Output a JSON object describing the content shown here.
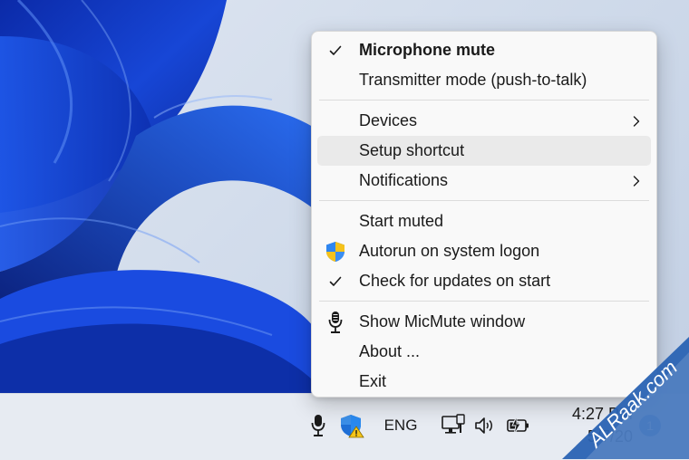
{
  "menu": {
    "items": [
      {
        "label": "Microphone mute",
        "checked": true,
        "bold": true,
        "icon": "",
        "submenu": false,
        "highlighted": false,
        "separator_after": false
      },
      {
        "label": "Transmitter mode (push-to-talk)",
        "checked": false,
        "bold": false,
        "icon": "",
        "submenu": false,
        "highlighted": false,
        "separator_after": true
      },
      {
        "label": "Devices",
        "checked": false,
        "bold": false,
        "icon": "",
        "submenu": true,
        "highlighted": false,
        "separator_after": false
      },
      {
        "label": "Setup shortcut",
        "checked": false,
        "bold": false,
        "icon": "",
        "submenu": false,
        "highlighted": true,
        "separator_after": false
      },
      {
        "label": "Notifications",
        "checked": false,
        "bold": false,
        "icon": "",
        "submenu": true,
        "highlighted": false,
        "separator_after": true
      },
      {
        "label": "Start muted",
        "checked": false,
        "bold": false,
        "icon": "",
        "submenu": false,
        "highlighted": false,
        "separator_after": false
      },
      {
        "label": "Autorun on system logon",
        "checked": false,
        "bold": false,
        "icon": "uac-shield-icon",
        "submenu": false,
        "highlighted": false,
        "separator_after": false
      },
      {
        "label": "Check for updates on start",
        "checked": true,
        "bold": false,
        "icon": "",
        "submenu": false,
        "highlighted": false,
        "separator_after": true
      },
      {
        "label": "Show MicMute window",
        "checked": false,
        "bold": false,
        "icon": "microphone-icon",
        "submenu": false,
        "highlighted": false,
        "separator_after": false
      },
      {
        "label": "About ...",
        "checked": false,
        "bold": false,
        "icon": "",
        "submenu": false,
        "highlighted": false,
        "separator_after": false
      },
      {
        "label": "Exit",
        "checked": false,
        "bold": false,
        "icon": "",
        "submenu": false,
        "highlighted": false,
        "separator_after": false
      }
    ]
  },
  "taskbar": {
    "language": "ENG",
    "time": "4:27 PM",
    "date": "5/7/20",
    "notification_count": "1",
    "tray_icons": [
      "microphone-icon",
      "security-shield-warning-icon",
      "network-icon",
      "volume-icon",
      "battery-charging-icon"
    ]
  },
  "watermark": {
    "text": "ALRaak.com"
  },
  "colors": {
    "menu_background": "#f9f9f9",
    "menu_highlight": "#eaeaea",
    "wallpaper_blue": "#1f4fd6",
    "taskbar_background": "#e7ebf2",
    "badge_blue": "#1f5fbd",
    "watermark_blue": "#2a63b3"
  }
}
